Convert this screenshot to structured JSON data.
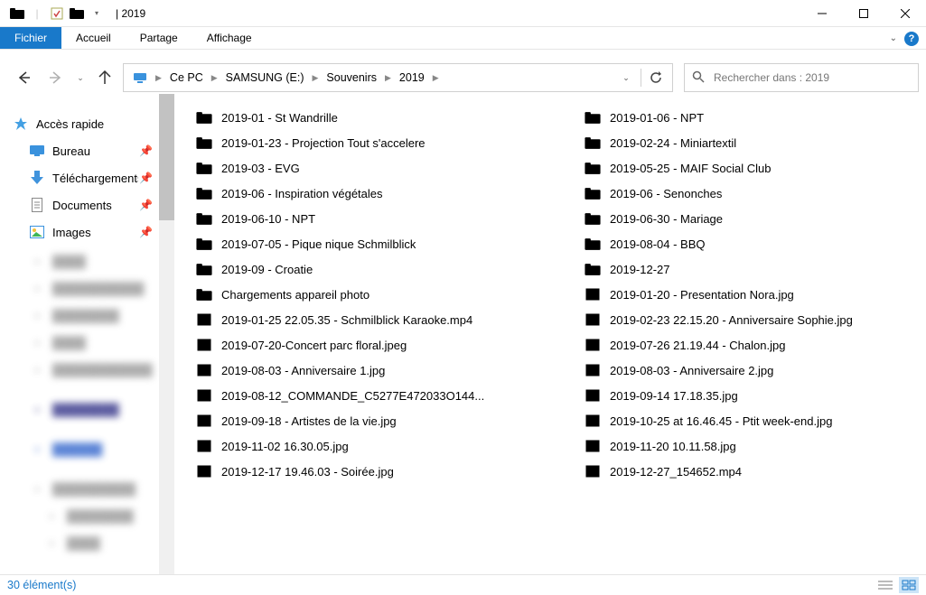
{
  "titlebar": {
    "title": "2019"
  },
  "ribbon": {
    "tabs": [
      "Fichier",
      "Accueil",
      "Partage",
      "Affichage"
    ]
  },
  "breadcrumbs": [
    "Ce PC",
    "SAMSUNG (E:)",
    "Souvenirs",
    "2019"
  ],
  "search": {
    "placeholder": "Rechercher dans : 2019"
  },
  "sidebar": {
    "quick": {
      "label": "Accès rapide"
    },
    "items": [
      {
        "label": "Bureau",
        "pinned": true
      },
      {
        "label": "Téléchargements",
        "pinned": true
      },
      {
        "label": "Documents",
        "pinned": true
      },
      {
        "label": "Images",
        "pinned": true
      }
    ]
  },
  "columns": [
    [
      {
        "type": "folder",
        "name": "2019-01 - St Wandrille"
      },
      {
        "type": "folder",
        "name": "2019-01-23 - Projection Tout s'accelere"
      },
      {
        "type": "folder",
        "name": "2019-03 - EVG"
      },
      {
        "type": "folder",
        "name": "2019-06 - Inspiration végétales"
      },
      {
        "type": "folder",
        "name": "2019-06-10 - NPT"
      },
      {
        "type": "folder",
        "name": "2019-07-05 - Pique nique Schmilblick"
      },
      {
        "type": "folder",
        "name": "2019-09 - Croatie"
      },
      {
        "type": "folder",
        "name": "Chargements appareil photo"
      },
      {
        "type": "video",
        "name": "2019-01-25 22.05.35 - Schmilblick Karaoke.mp4"
      },
      {
        "type": "image",
        "name": "2019-07-20-Concert parc floral.jpeg"
      },
      {
        "type": "image",
        "name": "2019-08-03 - Anniversaire 1.jpg"
      },
      {
        "type": "gif",
        "name": "2019-08-12_COMMANDE_C5277E472033O144..."
      },
      {
        "type": "image",
        "name": "2019-09-18 - Artistes de la vie.jpg"
      },
      {
        "type": "image",
        "name": "2019-11-02 16.30.05.jpg"
      },
      {
        "type": "image",
        "name": "2019-12-17 19.46.03 - Soirée.jpg"
      }
    ],
    [
      {
        "type": "folder",
        "name": "2019-01-06 - NPT"
      },
      {
        "type": "folder",
        "name": "2019-02-24 - Miniartextil"
      },
      {
        "type": "folder",
        "name": "2019-05-25 - MAIF Social Club"
      },
      {
        "type": "folder",
        "name": "2019-06 - Senonches"
      },
      {
        "type": "folder",
        "name": "2019-06-30 - Mariage"
      },
      {
        "type": "folder",
        "name": "2019-08-04 - BBQ"
      },
      {
        "type": "folder",
        "name": "2019-12-27"
      },
      {
        "type": "image",
        "name": "2019-01-20 - Presentation Nora.jpg"
      },
      {
        "type": "image",
        "name": "2019-02-23 22.15.20 - Anniversaire Sophie.jpg"
      },
      {
        "type": "image",
        "name": "2019-07-26 21.19.44 - Chalon.jpg"
      },
      {
        "type": "image",
        "name": "2019-08-03 - Anniversaire 2.jpg"
      },
      {
        "type": "image",
        "name": "2019-09-14 17.18.35.jpg"
      },
      {
        "type": "image",
        "name": "2019-10-25 at 16.46.45 - Ptit week-end.jpg"
      },
      {
        "type": "image",
        "name": "2019-11-20 10.11.58.jpg"
      },
      {
        "type": "video",
        "name": "2019-12-27_154652.mp4"
      }
    ]
  ],
  "status": {
    "text": "30 élément(s)"
  }
}
